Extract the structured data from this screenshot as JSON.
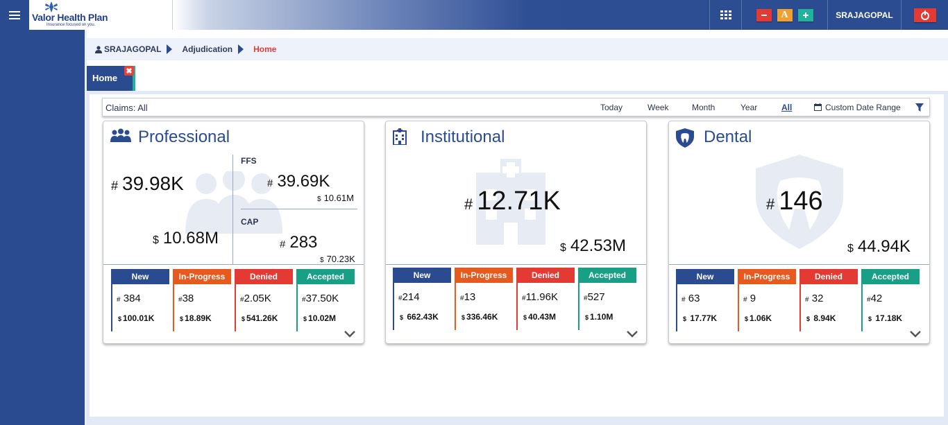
{
  "header": {
    "logo_text": "Valor Health Plan",
    "logo_tagline": "Insurance focused on you.",
    "user": "SRAJAGOPAL",
    "icons": [
      "menu-icon",
      "apps-grid-icon",
      "font-decrease-icon",
      "font-reset-icon",
      "font-increase-icon",
      "power-icon"
    ],
    "font_reset_label": "A"
  },
  "breadcrumb": {
    "user": "SRAJAGOPAL",
    "section": "Adjudication",
    "current": "Home"
  },
  "tab": {
    "label": "Home"
  },
  "claims_bar": {
    "title": "Claims: All",
    "periods": [
      "Today",
      "Week",
      "Month",
      "Year",
      "All"
    ],
    "active_period": "All",
    "custom_range": "Custom Date Range"
  },
  "symbols": {
    "hash": "#",
    "dollar": "$"
  },
  "cards": {
    "professional": {
      "title": "Professional",
      "total_count": "39.98K",
      "total_amount": "10.68M",
      "ffs_label": "FFS",
      "ffs_count": "39.69K",
      "ffs_amount": "10.61M",
      "cap_label": "CAP",
      "cap_count": "283",
      "cap_amount": "70.23K",
      "statuses": [
        {
          "label": "New",
          "count": "384",
          "amount": "100.01K"
        },
        {
          "label": "In-Progress",
          "count": "38",
          "amount": "18.89K"
        },
        {
          "label": "Denied",
          "count": "2.05K",
          "amount": "541.26K"
        },
        {
          "label": "Accepted",
          "count": "37.50K",
          "amount": "10.02M"
        }
      ]
    },
    "institutional": {
      "title": "Institutional",
      "total_count": "12.71K",
      "total_amount": "42.53M",
      "statuses": [
        {
          "label": "New",
          "count": "214",
          "amount": "662.43K"
        },
        {
          "label": "In-Progress",
          "count": "13",
          "amount": "336.46K"
        },
        {
          "label": "Denied",
          "count": "11.96K",
          "amount": "40.43M"
        },
        {
          "label": "Accepted",
          "count": "527",
          "amount": "1.10M"
        }
      ]
    },
    "dental": {
      "title": "Dental",
      "total_count": "146",
      "total_amount": "44.94K",
      "statuses": [
        {
          "label": "New",
          "count": "63",
          "amount": "17.77K"
        },
        {
          "label": "In-Progress",
          "count": "9",
          "amount": "1.06K"
        },
        {
          "label": "Denied",
          "count": "32",
          "amount": "8.94K"
        },
        {
          "label": "Accepted",
          "count": "42",
          "amount": "17.18K"
        }
      ]
    }
  },
  "colors": {
    "primary": "#2b4b91",
    "new": "#2b4b91",
    "in_progress": "#e8591d",
    "denied": "#e33b34",
    "accepted": "#17a085",
    "active_breadcrumb": "#e83b3b"
  }
}
